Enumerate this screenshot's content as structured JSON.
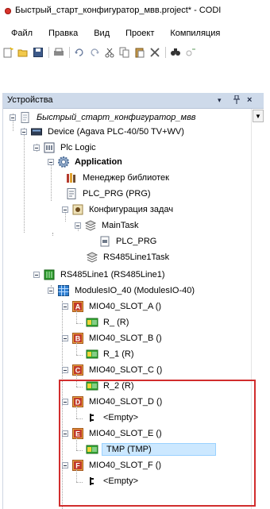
{
  "window": {
    "title": "Быстрый_старт_конфигуратор_мвв.project* - CODI"
  },
  "menu": [
    "Файл",
    "Правка",
    "Вид",
    "Проект",
    "Компиляция"
  ],
  "toolbar": [
    "new-project-icon",
    "open-icon",
    "save-icon",
    "print-icon",
    "undo-icon",
    "redo-icon",
    "cut-icon",
    "copy-icon",
    "paste-icon",
    "delete-icon",
    "find-icon",
    "replace-icon"
  ],
  "devices_panel": {
    "title": "Устройства",
    "pin": "ᵖ",
    "close": "×",
    "dropdown": "▾"
  },
  "tree": {
    "project": "Быстрый_старт_конфигуратор_мвв",
    "device": "Device (Agava PLC-40/50 TV+WV)",
    "plc_logic": "Plc Logic",
    "application": "Application",
    "library_manager": "Менеджер библиотек",
    "plc_prg": "PLC_PRG (PRG)",
    "task_config": "Конфигурация задач",
    "main_task": "MainTask",
    "main_task_prg": "PLC_PRG",
    "rs485_task": "RS485Line1Task",
    "rs485_line": "RS485Line1 (RS485Line1)",
    "modules": "ModulesIO_40 (ModulesIO-40)",
    "slots": [
      {
        "letter": "A",
        "name": "MIO40_SLOT_A ()",
        "child": "R_ (R)"
      },
      {
        "letter": "B",
        "name": "MIO40_SLOT_B ()",
        "child": "R_1 (R)"
      },
      {
        "letter": "C",
        "name": "MIO40_SLOT_C ()",
        "child": "R_2 (R)"
      },
      {
        "letter": "D",
        "name": "MIO40_SLOT_D ()",
        "child": "<Empty>"
      },
      {
        "letter": "E",
        "name": "MIO40_SLOT_E ()",
        "child": "TMP (TMP)"
      },
      {
        "letter": "F",
        "name": "MIO40_SLOT_F ()",
        "child": "<Empty>"
      }
    ]
  },
  "colors": {
    "panel_header": "#cedaea",
    "highlight_box": "#d12d2d",
    "selection": "#cce8ff",
    "slot_icon": "#c0392b"
  }
}
